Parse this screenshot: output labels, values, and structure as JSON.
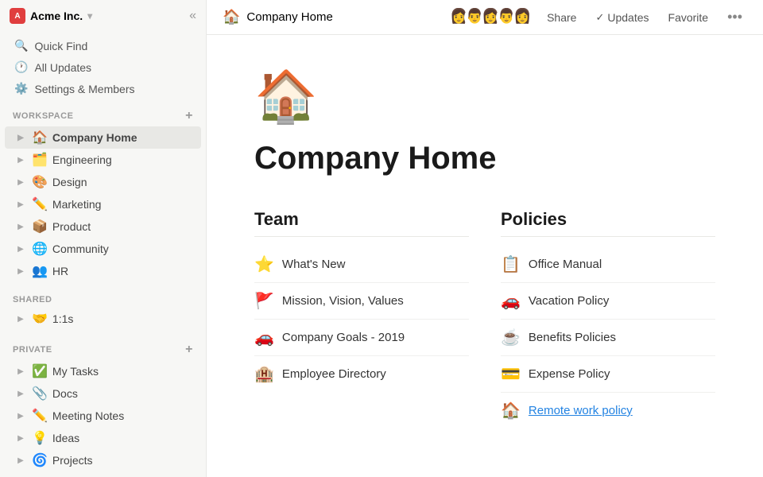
{
  "sidebar": {
    "workspace_name": "Acme Inc.",
    "workspace_initials": "A",
    "collapse_icon": "«",
    "nav_items": [
      {
        "id": "quick-find",
        "icon": "🔍",
        "label": "Quick Find"
      },
      {
        "id": "all-updates",
        "icon": "🕐",
        "label": "All Updates"
      },
      {
        "id": "settings",
        "icon": "⚙️",
        "label": "Settings & Members"
      }
    ],
    "workspace_section": "WORKSPACE",
    "workspace_items": [
      {
        "id": "company-home",
        "emoji": "🏠",
        "label": "Company Home",
        "active": true
      },
      {
        "id": "engineering",
        "emoji": "🗂️",
        "label": "Engineering"
      },
      {
        "id": "design",
        "emoji": "🎨",
        "label": "Design"
      },
      {
        "id": "marketing",
        "emoji": "✏️",
        "label": "Marketing"
      },
      {
        "id": "product",
        "emoji": "📦",
        "label": "Product"
      },
      {
        "id": "community",
        "emoji": "🌐",
        "label": "Community"
      },
      {
        "id": "hr",
        "emoji": "👥",
        "label": "HR"
      }
    ],
    "shared_section": "SHARED",
    "shared_items": [
      {
        "id": "1on1s",
        "emoji": "🤝",
        "label": "1:1s"
      }
    ],
    "private_section": "PRIVATE",
    "private_items": [
      {
        "id": "my-tasks",
        "emoji": "✅",
        "label": "My Tasks"
      },
      {
        "id": "docs",
        "emoji": "📎",
        "label": "Docs"
      },
      {
        "id": "meeting-notes",
        "emoji": "✏️",
        "label": "Meeting Notes"
      },
      {
        "id": "ideas",
        "emoji": "💡",
        "label": "Ideas"
      },
      {
        "id": "projects",
        "emoji": "🌀",
        "label": "Projects"
      }
    ]
  },
  "topbar": {
    "page_emoji": "🏠",
    "page_title": "Company Home",
    "share_label": "Share",
    "updates_label": "Updates",
    "favorite_label": "Favorite",
    "more_icon": "•••"
  },
  "page": {
    "icon": "🏠",
    "title": "Company Home",
    "team_section": {
      "heading": "Team",
      "items": [
        {
          "emoji": "⭐",
          "label": "What's New"
        },
        {
          "emoji": "🚩",
          "label": "Mission, Vision, Values"
        },
        {
          "emoji": "🚗",
          "label": "Company Goals - 2019"
        },
        {
          "emoji": "🏨",
          "label": "Employee Directory"
        }
      ]
    },
    "policies_section": {
      "heading": "Policies",
      "items": [
        {
          "emoji": "📋",
          "label": "Office Manual"
        },
        {
          "emoji": "🚗",
          "label": "Vacation Policy"
        },
        {
          "emoji": "☕",
          "label": "Benefits Policies"
        },
        {
          "emoji": "💳",
          "label": "Expense Policy"
        },
        {
          "emoji": "🏠",
          "label": "Remote work policy",
          "underline": true
        }
      ]
    }
  }
}
